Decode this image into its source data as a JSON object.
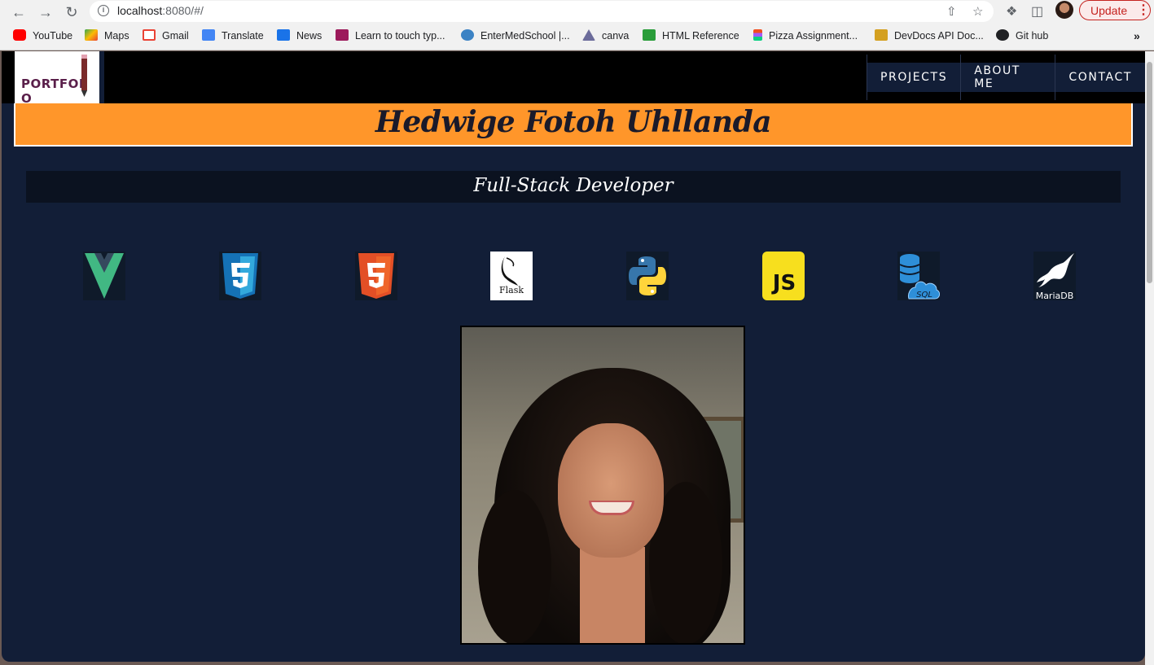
{
  "browser": {
    "url_host": "localhost",
    "url_path": ":8080/#/",
    "update_label": "Update"
  },
  "bookmarks": [
    {
      "label": "YouTube",
      "color": "#ff0000"
    },
    {
      "label": "Maps",
      "color": "#34a853"
    },
    {
      "label": "Gmail",
      "color": "#ea4335"
    },
    {
      "label": "Translate",
      "color": "#4285f4"
    },
    {
      "label": "News",
      "color": "#1a73e8"
    },
    {
      "label": "Learn to touch typ...",
      "color": "#9c1a5b"
    },
    {
      "label": "EnterMedSchool |...",
      "color": "#3b82c4"
    },
    {
      "label": "canva",
      "color": "#6b6b9a"
    },
    {
      "label": "HTML Reference",
      "color": "#2a9d3a"
    },
    {
      "label": "Pizza Assignment...",
      "color": "#f24e1e"
    },
    {
      "label": "DevDocs API Doc...",
      "color": "#d4a020"
    },
    {
      "label": "Git hub",
      "color": "#202124"
    }
  ],
  "site": {
    "logo_text": "PORTFOL",
    "logo_text_end": "O",
    "nav": [
      "PROJECTS",
      "ABOUT ME",
      "CONTACT"
    ],
    "name": "Hedwige Fotoh Uhllanda",
    "role": "Full-Stack Developer",
    "skills": [
      "vue-icon",
      "css3-icon",
      "html5-icon",
      "flask-icon",
      "python-icon",
      "javascript-icon",
      "sql-icon",
      "mariadb-icon"
    ],
    "skill_labels": {
      "flask": "Flask",
      "js": "JS",
      "sql": "SQL",
      "mariadb": "MariaDB"
    }
  },
  "colors": {
    "page_bg": "#121e37",
    "banner": "#ff962a",
    "nav_bg": "#000000"
  }
}
